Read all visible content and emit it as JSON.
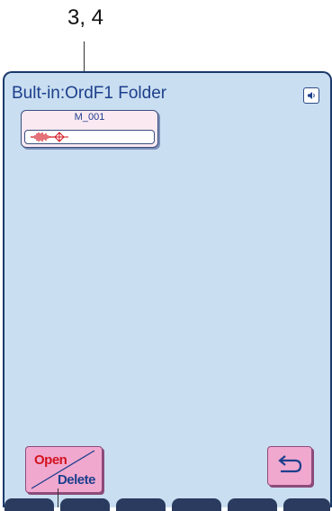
{
  "callout": {
    "label": "3, 4"
  },
  "screen": {
    "title": "Bult-in:OrdF1 Folder",
    "speaker_icon": "speaker-icon",
    "files": [
      {
        "name": "M_001",
        "icon": "waveform-icon"
      }
    ]
  },
  "buttons": {
    "open_delete": {
      "open_label": "Open",
      "delete_label": "Delete"
    },
    "return": {
      "icon": "return-arrow-icon"
    }
  },
  "colors": {
    "screen_bg": "#c9def0",
    "button_bg": "#f1a8cf",
    "open_text": "#d2141f",
    "delete_text": "#1d3f8c",
    "frame": "#1b3a6b"
  }
}
